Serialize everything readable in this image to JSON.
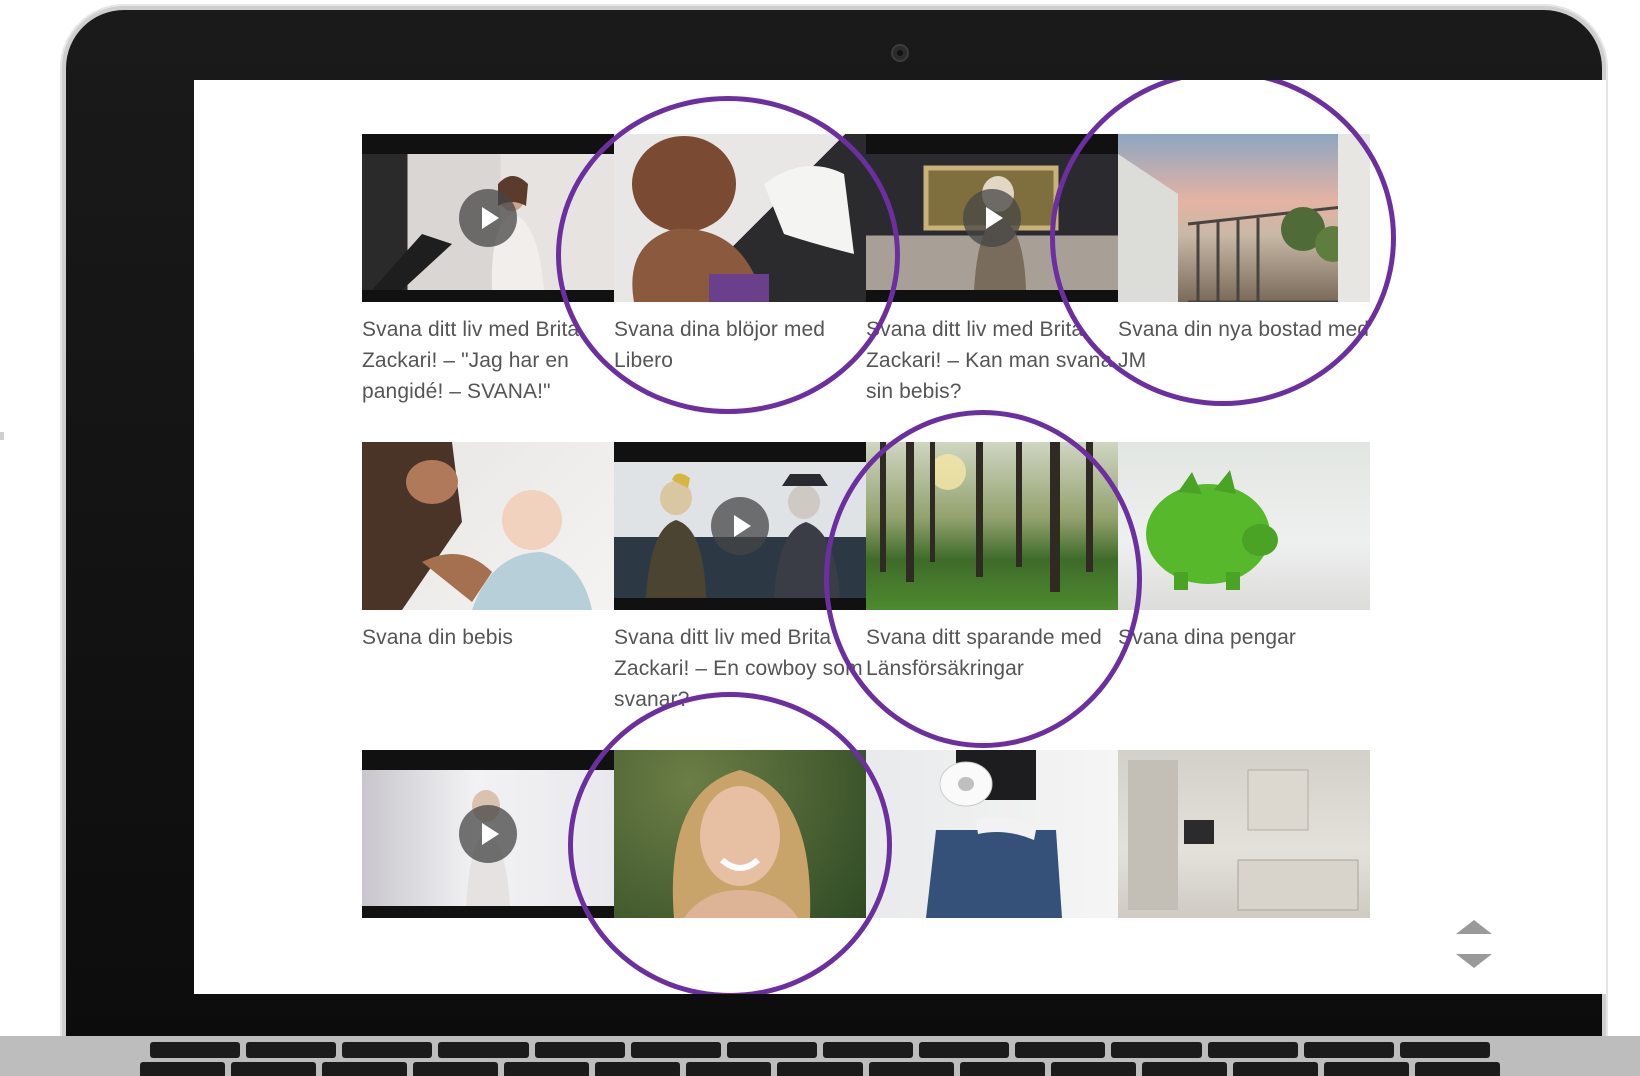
{
  "articles": [
    {
      "title": "Svana ditt liv med Brita Zackari! – \"Jag har en pangidé! – SVANA!\"",
      "is_video": true,
      "thumb_subject": "woman-at-piano"
    },
    {
      "title": "Svana dina blöjor med Libero",
      "is_video": false,
      "thumb_subject": "baby-with-diaper",
      "highlighted": true
    },
    {
      "title": "Svana ditt liv med Brita Zackari! – Kan man svana sin bebis?",
      "is_video": true,
      "thumb_subject": "woman-in-room-with-painting"
    },
    {
      "title": "Svana din nya bostad med JM",
      "is_video": false,
      "thumb_subject": "apartment-balcony",
      "highlighted": true
    },
    {
      "title": "Svana din bebis",
      "is_video": false,
      "thumb_subject": "father-with-baby"
    },
    {
      "title": "Svana ditt liv med Brita Zackari! – En cowboy som svanar?",
      "is_video": true,
      "thumb_subject": "two-people-on-boat"
    },
    {
      "title": "Svana ditt sparande med Länsförsäkringar",
      "is_video": false,
      "thumb_subject": "pine-forest",
      "highlighted": true
    },
    {
      "title": "Svana dina pengar",
      "is_video": false,
      "thumb_subject": "green-piggy-bank"
    },
    {
      "title": "",
      "is_video": true,
      "thumb_subject": "video-still-white-room"
    },
    {
      "title": "",
      "is_video": false,
      "thumb_subject": "smiling-blonde-woman",
      "highlighted": true
    },
    {
      "title": "",
      "is_video": false,
      "thumb_subject": "toilet-paper-roll"
    },
    {
      "title": "",
      "is_video": false,
      "thumb_subject": "grey-kitchen"
    }
  ],
  "colors": {
    "highlight_ring": "#6b2fa0",
    "caption_text": "#555555",
    "bezel": "#111111"
  },
  "icons": {
    "play": "play-icon",
    "scroll": "scroll-arrows-icon"
  }
}
